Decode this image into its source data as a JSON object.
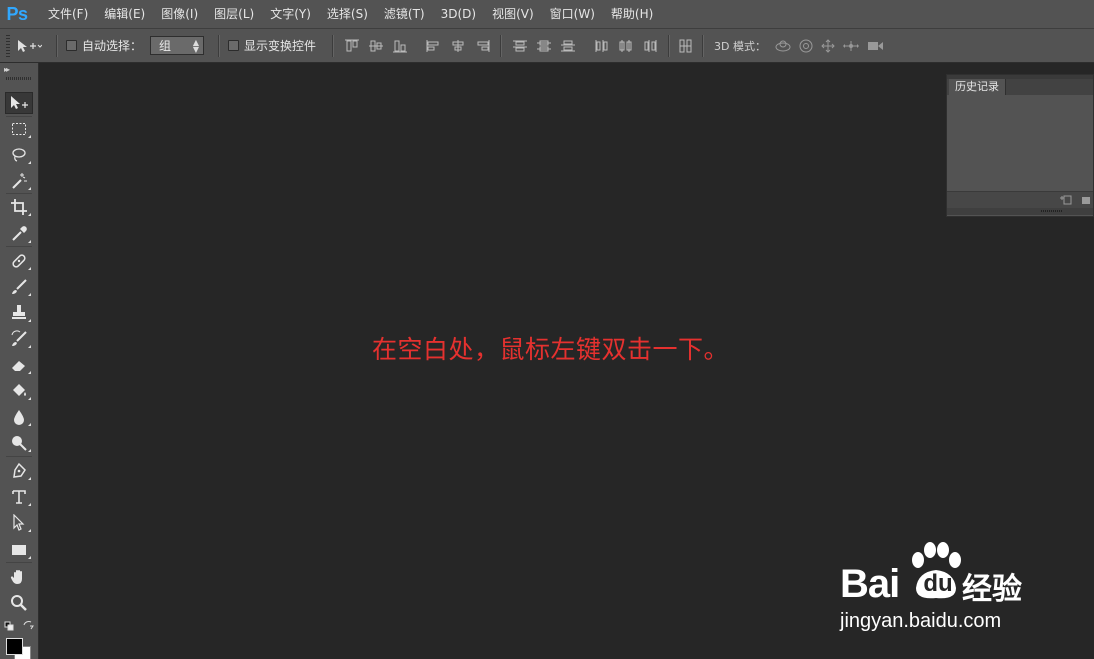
{
  "app": {
    "logo": "Ps"
  },
  "menu": {
    "items": [
      {
        "label": "文件(F)"
      },
      {
        "label": "编辑(E)"
      },
      {
        "label": "图像(I)"
      },
      {
        "label": "图层(L)"
      },
      {
        "label": "文字(Y)"
      },
      {
        "label": "选择(S)"
      },
      {
        "label": "滤镜(T)"
      },
      {
        "label": "3D(D)"
      },
      {
        "label": "视图(V)"
      },
      {
        "label": "窗口(W)"
      },
      {
        "label": "帮助(H)"
      }
    ]
  },
  "options": {
    "tool_icon": "move-tool-icon",
    "auto_select": {
      "label": "自动选择：",
      "checked": false
    },
    "auto_select_target": {
      "value": "组"
    },
    "show_transform": {
      "label": "显示变换控件",
      "checked": false
    },
    "mode_3d_label": "3D 模式："
  },
  "toolbox": {
    "tools": [
      {
        "name": "move-tool",
        "icon": "move-icon",
        "active": true
      },
      {
        "name": "marquee-tool",
        "icon": "rect-marquee-icon"
      },
      {
        "name": "lasso-tool",
        "icon": "lasso-icon"
      },
      {
        "name": "magic-wand-tool",
        "icon": "magic-wand-icon"
      },
      {
        "name": "crop-tool",
        "icon": "crop-icon"
      },
      {
        "name": "eyedropper-tool",
        "icon": "eyedropper-icon"
      },
      {
        "name": "healing-brush-tool",
        "icon": "bandage-icon"
      },
      {
        "name": "brush-tool",
        "icon": "brush-icon"
      },
      {
        "name": "clone-stamp-tool",
        "icon": "stamp-icon"
      },
      {
        "name": "history-brush-tool",
        "icon": "history-brush-icon"
      },
      {
        "name": "eraser-tool",
        "icon": "eraser-icon"
      },
      {
        "name": "paint-bucket-tool",
        "icon": "paint-bucket-icon"
      },
      {
        "name": "blur-tool",
        "icon": "drop-icon"
      },
      {
        "name": "dodge-tool",
        "icon": "dodge-icon"
      },
      {
        "name": "pen-tool",
        "icon": "pen-icon"
      },
      {
        "name": "type-tool",
        "icon": "type-icon"
      },
      {
        "name": "path-selection-tool",
        "icon": "arrow-select-icon"
      },
      {
        "name": "shape-tool",
        "icon": "rectangle-icon"
      },
      {
        "name": "hand-tool",
        "icon": "hand-icon"
      },
      {
        "name": "zoom-tool",
        "icon": "magnifier-icon"
      }
    ],
    "foreground_color": "#000000",
    "background_color": "#ffffff"
  },
  "history_panel": {
    "tab_label": "历史记录"
  },
  "canvas": {
    "annotation": "在空白处，鼠标左键双击一下。",
    "annotation_color": "#e5312f",
    "background": "#262626"
  },
  "watermark": {
    "brand_left": "Bai",
    "brand_paw_text": "du",
    "brand_right": "经验",
    "url": "jingyan.baidu.com"
  }
}
